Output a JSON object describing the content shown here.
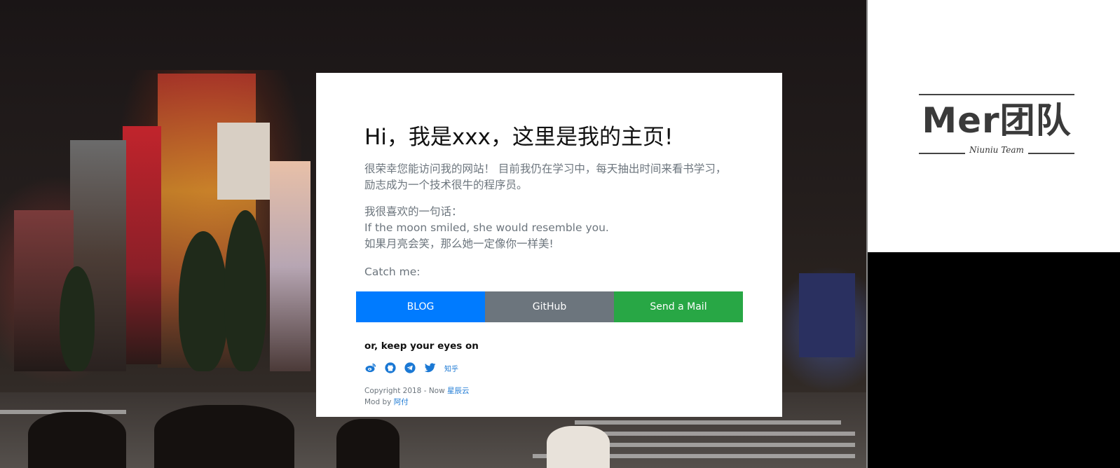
{
  "hero": {
    "title": "Hi，我是xxx，这里是我的主页!",
    "intro": "很荣幸您能访问我的网站！ 目前我仍在学习中，每天抽出时间来看书学习，励志成为一个技术很牛的程序员。",
    "quote_heading": "我很喜欢的一句话：",
    "quote_en": "If the moon smiled, she would resemble you.",
    "quote_zh": "如果月亮会笑，那么她一定像你一样美!",
    "catch_me": "Catch me:"
  },
  "buttons": {
    "blog": "BLOG",
    "github": "GitHub",
    "mail": "Send a Mail"
  },
  "social": {
    "heading": "or, keep your eyes on",
    "icons": [
      "weibo-icon",
      "github-icon",
      "telegram-icon",
      "twitter-icon"
    ],
    "zhihu": "知乎"
  },
  "footer": {
    "copyright": "Copyright 2018 - Now",
    "copyright_link": "星辰云",
    "mod_by": "Mod by",
    "mod_link": "阿付"
  },
  "logo": {
    "word": "Mer团队",
    "sub": "Niuniu Team"
  },
  "colors": {
    "blog": "#007bff",
    "github": "#6c757d",
    "mail": "#28a745",
    "link": "#1a78d4"
  }
}
